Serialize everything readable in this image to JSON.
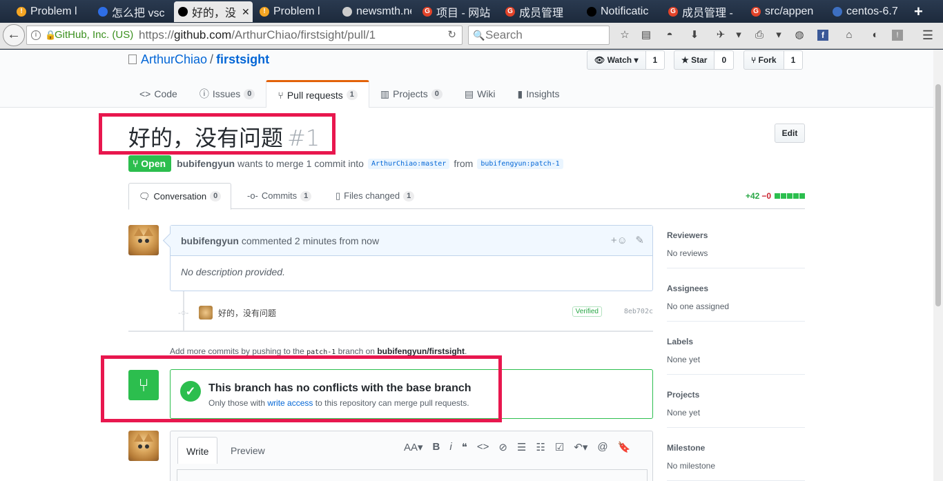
{
  "browser": {
    "tabs": [
      {
        "icon": "warning-icon",
        "label": "Problem l",
        "iconbg": "#f5a623"
      },
      {
        "icon": "baidu-icon",
        "label": "怎么把 vsc",
        "iconbg": "#2e6ee6"
      },
      {
        "icon": "github-icon",
        "label": "好的，没",
        "iconbg": "#000000"
      },
      {
        "icon": "warning-icon",
        "label": "Problem l",
        "iconbg": "#f5a623"
      },
      {
        "icon": "page-icon",
        "label": "newsmth.net",
        "iconbg": "#cccccc"
      },
      {
        "icon": "gitlab-g-icon",
        "label": "项目 - 网站",
        "iconbg": "#e24329"
      },
      {
        "icon": "gitlab-g-icon",
        "label": "成员管理",
        "iconbg": "#e24329"
      },
      {
        "icon": "github-icon",
        "label": "Notificatic",
        "iconbg": "#000000"
      },
      {
        "icon": "gitlab-g-icon",
        "label": "成员管理 -",
        "iconbg": "#e24329"
      },
      {
        "icon": "gitlab-g-icon",
        "label": "src/appen",
        "iconbg": "#e24329"
      },
      {
        "icon": "centos-icon",
        "label": "centos-6.7",
        "iconbg": "#3d6fc1"
      }
    ],
    "new_tab": "+",
    "close_glyph": "✕",
    "back_glyph": "←",
    "site_identity": "GitHub, Inc. (US)",
    "url_prefix": "https://",
    "url_domain": "github.com",
    "url_path": "/ArthurChiao/firstsight/pull/1",
    "search_placeholder": "Search"
  },
  "repo": {
    "owner": "ArthurChiao",
    "separator": "/",
    "name": "firstsight",
    "watch_label": "Watch",
    "watch_count": "1",
    "star_label": "Star",
    "star_count": "0",
    "fork_label": "Fork",
    "fork_count": "1",
    "nav": [
      {
        "label": "Code",
        "count": null
      },
      {
        "label": "Issues",
        "count": "0"
      },
      {
        "label": "Pull requests",
        "count": "1"
      },
      {
        "label": "Projects",
        "count": "0"
      },
      {
        "label": "Wiki",
        "count": null
      },
      {
        "label": "Insights",
        "count": null
      }
    ]
  },
  "pr": {
    "title": "好的，没有问题",
    "number": "#1",
    "edit_label": "Edit",
    "state": "Open",
    "author": "bubifengyun",
    "merge_text": "wants to merge 1 commit into",
    "base_branch": "ArthurChiao:master",
    "from_text": "from",
    "head_branch": "bubifengyun:patch-1",
    "tabs": [
      {
        "label": "Conversation",
        "count": "0"
      },
      {
        "label": "Commits",
        "count": "1"
      },
      {
        "label": "Files changed",
        "count": "1"
      }
    ],
    "additions": "+42",
    "deletions": "−0",
    "diff_blocks": 5
  },
  "comment": {
    "author": "bubifengyun",
    "action": "commented 2 minutes from now",
    "body": "No description provided.",
    "react_glyph": "+☺",
    "edit_glyph": "✎"
  },
  "commit": {
    "message": "好的，没有问题",
    "verified": "Verified",
    "sha": "8eb702c"
  },
  "addmore": {
    "prefix": "Add more commits by pushing to the",
    "branch": "patch-1",
    "middle": "branch on",
    "repo": "bubifengyun/firstsight",
    "suffix": "."
  },
  "merge": {
    "heading": "This branch has no conflicts with the base branch",
    "sub_prefix": "Only those with",
    "sub_link": "write access",
    "sub_suffix": "to this repository can merge pull requests."
  },
  "composer": {
    "write_label": "Write",
    "preview_label": "Preview",
    "tools": [
      "AA▾",
      "B",
      "i",
      "❝",
      "<>",
      "⊘",
      "☰",
      "☷",
      "☑",
      "↶▾",
      "@",
      "🔖"
    ]
  },
  "sidebar": [
    {
      "title": "Reviewers",
      "value": "No reviews"
    },
    {
      "title": "Assignees",
      "value": "No one assigned"
    },
    {
      "title": "Labels",
      "value": "None yet"
    },
    {
      "title": "Projects",
      "value": "None yet"
    },
    {
      "title": "Milestone",
      "value": "No milestone"
    }
  ],
  "colors": {
    "highlight_box": "#e8174e",
    "open_green": "#2cbe4e",
    "link_blue": "#0366d6"
  }
}
